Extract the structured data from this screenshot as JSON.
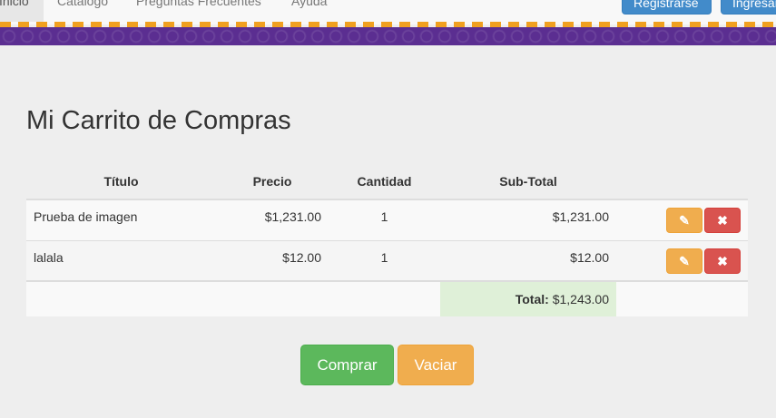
{
  "nav": {
    "links": [
      "Inicio",
      "Catalogo",
      "Preguntas Frecuentes",
      "Ayuda"
    ],
    "register_label": "Registrarse",
    "login_label": "Ingresar"
  },
  "cart": {
    "title": "Mi Carrito de Compras",
    "headers": {
      "title": "Título",
      "price": "Precio",
      "quantity": "Cantidad",
      "subtotal": "Sub-Total"
    },
    "rows": [
      {
        "title": "Prueba de imagen",
        "price": "$1,231.00",
        "quantity": "1",
        "subtotal": "$1,231.00"
      },
      {
        "title": "lalala",
        "price": "$12.00",
        "quantity": "1",
        "subtotal": "$12.00"
      }
    ],
    "total_label": "Total:",
    "total_value": "$1,243.00",
    "edit_icon": "edit-icon",
    "delete_icon": "close-icon"
  },
  "actions": {
    "buy_label": "Comprar",
    "empty_label": "Vaciar"
  },
  "colors": {
    "purple_band": "#5b2e91",
    "dash": "#f0a020",
    "primary": "#428bca",
    "success": "#5cb85c",
    "warning": "#f0ad4e",
    "danger": "#d9534f"
  }
}
